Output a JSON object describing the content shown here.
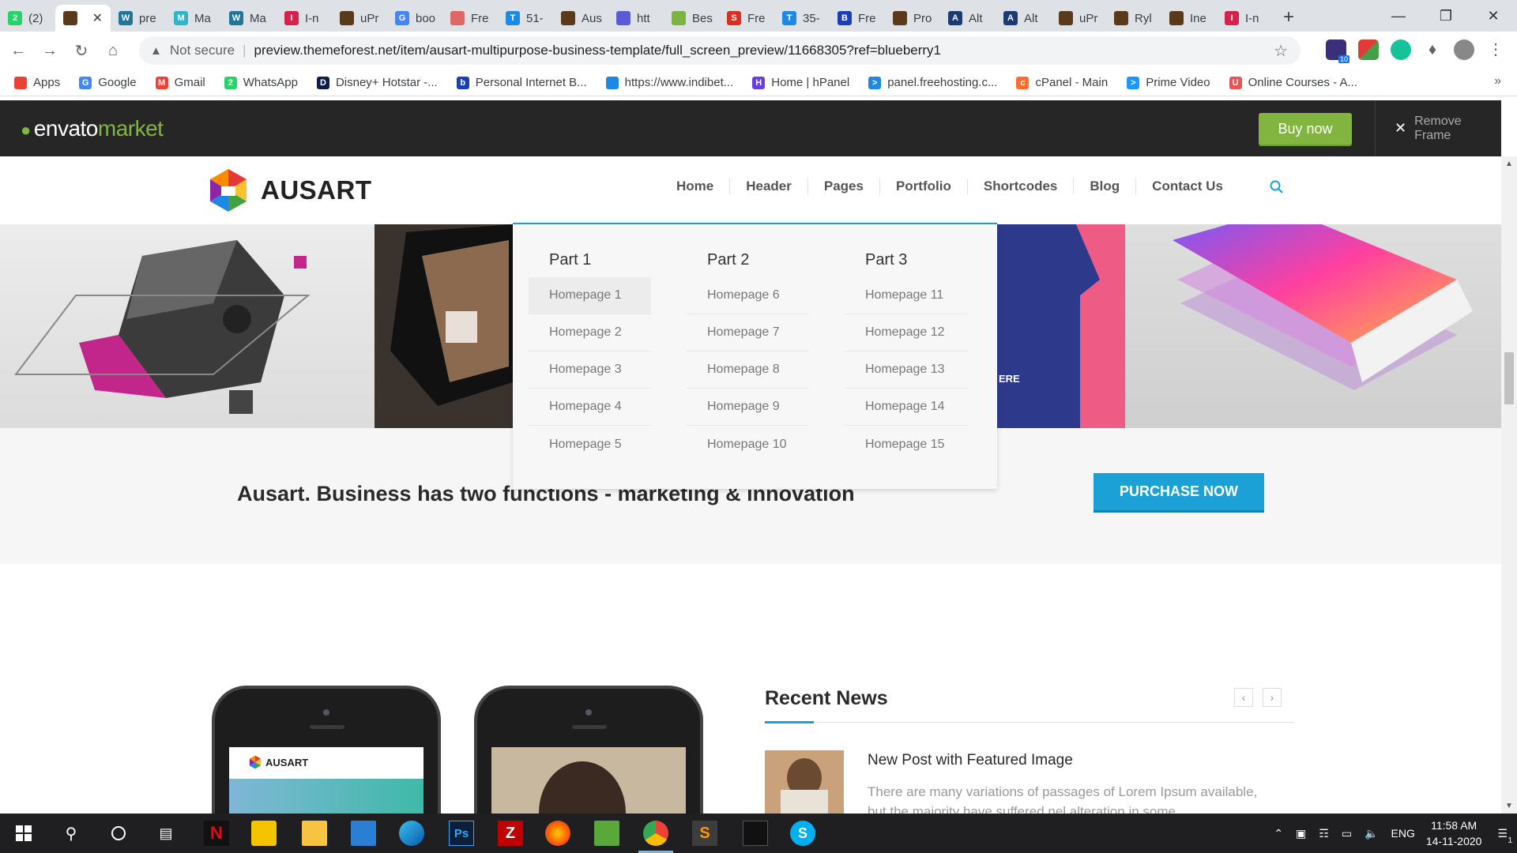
{
  "browser": {
    "tabs": [
      {
        "label": "(2)",
        "color": "#25d366",
        "glyph": "2"
      },
      {
        "label": "",
        "color": "#5a3a1a",
        "glyph": "",
        "active": true
      },
      {
        "label": "pre",
        "color": "#21759b",
        "glyph": "W"
      },
      {
        "label": "Ma",
        "color": "#31b4c4",
        "glyph": "M"
      },
      {
        "label": "Ma",
        "color": "#21759b",
        "glyph": "W"
      },
      {
        "label": "I-n",
        "color": "#d6214d",
        "glyph": "I"
      },
      {
        "label": "uPr",
        "color": "#5a3a1a",
        "glyph": ""
      },
      {
        "label": "boo",
        "color": "#4285f4",
        "glyph": "G"
      },
      {
        "label": "Fre",
        "color": "#e06666",
        "glyph": ""
      },
      {
        "label": "51-",
        "color": "#1e88e5",
        "glyph": "T"
      },
      {
        "label": "Aus",
        "color": "#5a3a1a",
        "glyph": ""
      },
      {
        "label": "htt",
        "color": "#5b5bd6",
        "glyph": ""
      },
      {
        "label": "Bes",
        "color": "#7cb342",
        "glyph": ""
      },
      {
        "label": "Fre",
        "color": "#d93025",
        "glyph": "S"
      },
      {
        "label": "35-",
        "color": "#1e88e5",
        "glyph": "T"
      },
      {
        "label": "Fre",
        "color": "#1a3fb5",
        "glyph": "B"
      },
      {
        "label": "Pro",
        "color": "#5a3a1a",
        "glyph": ""
      },
      {
        "label": "Alt",
        "color": "#1c3b72",
        "glyph": "A"
      },
      {
        "label": "Alt",
        "color": "#1c3b72",
        "glyph": "A"
      },
      {
        "label": "uPr",
        "color": "#5a3a1a",
        "glyph": ""
      },
      {
        "label": "Ryl",
        "color": "#5a3a1a",
        "glyph": ""
      },
      {
        "label": "Ine",
        "color": "#5a3a1a",
        "glyph": ""
      },
      {
        "label": "I-n",
        "color": "#d6214d",
        "glyph": "I"
      }
    ],
    "new_tab": "+",
    "not_secure": "Not secure",
    "url": "preview.themeforest.net/item/ausart-multipurpose-business-template/full_screen_preview/11668305?ref=blueberry1",
    "extension_badge": "10"
  },
  "bookmarks": [
    {
      "label": "Apps",
      "color": "#ea4335",
      "glyph": ""
    },
    {
      "label": "Google",
      "color": "#4285f4",
      "glyph": "G"
    },
    {
      "label": "Gmail",
      "color": "#ea4335",
      "glyph": "M"
    },
    {
      "label": "WhatsApp",
      "color": "#25d366",
      "glyph": "2"
    },
    {
      "label": "Disney+ Hotstar -...",
      "color": "#0f1a4a",
      "glyph": "D"
    },
    {
      "label": "Personal Internet B...",
      "color": "#1a3fb5",
      "glyph": "b"
    },
    {
      "label": "https://www.indibet...",
      "color": "#1e88e5",
      "glyph": ""
    },
    {
      "label": "Home | hPanel",
      "color": "#673de6",
      "glyph": "H"
    },
    {
      "label": "panel.freehosting.c...",
      "color": "#1e88e5",
      "glyph": ">"
    },
    {
      "label": "cPanel - Main",
      "color": "#ff6c2c",
      "glyph": "c"
    },
    {
      "label": "Prime Video",
      "color": "#1a98ff",
      "glyph": ">"
    },
    {
      "label": "Online Courses - A...",
      "color": "#ec5252",
      "glyph": "U"
    }
  ],
  "envato": {
    "logo_main": "envato",
    "logo_sub": "market",
    "buy_now": "Buy now",
    "remove_frame": "Remove Frame"
  },
  "site": {
    "logo_text": "AUSART",
    "nav": [
      "Home",
      "Header",
      "Pages",
      "Portfolio",
      "Shortcodes",
      "Blog",
      "Contact Us"
    ],
    "megamenu": [
      {
        "title": "Part 1",
        "items": [
          "Homepage 1",
          "Homepage 2",
          "Homepage 3",
          "Homepage 4",
          "Homepage 5"
        ]
      },
      {
        "title": "Part 2",
        "items": [
          "Homepage 6",
          "Homepage 7",
          "Homepage 8",
          "Homepage 9",
          "Homepage 10"
        ]
      },
      {
        "title": "Part 3",
        "items": [
          "Homepage 11",
          "Homepage 12",
          "Homepage 13",
          "Homepage 14",
          "Homepage 15"
        ]
      }
    ],
    "cta_text": "Ausart. Business has two functions - marketing & innovation",
    "purchase_button": "PURCHASE NOW",
    "phone_logo_text": "AUSART",
    "news": {
      "heading": "Recent News",
      "prev": "‹",
      "next": "›",
      "post_title": "New Post with Featured Image",
      "post_excerpt": "There are many variations of passages of Lorem Ipsum available, but the majority have suffered nel alteration in some..."
    },
    "accent_color": "#1ba1d5",
    "envato_green": "#82b540"
  },
  "taskbar": {
    "language": "ENG",
    "time": "11:58 AM",
    "date": "14-11-2020",
    "notification_count": "1"
  }
}
